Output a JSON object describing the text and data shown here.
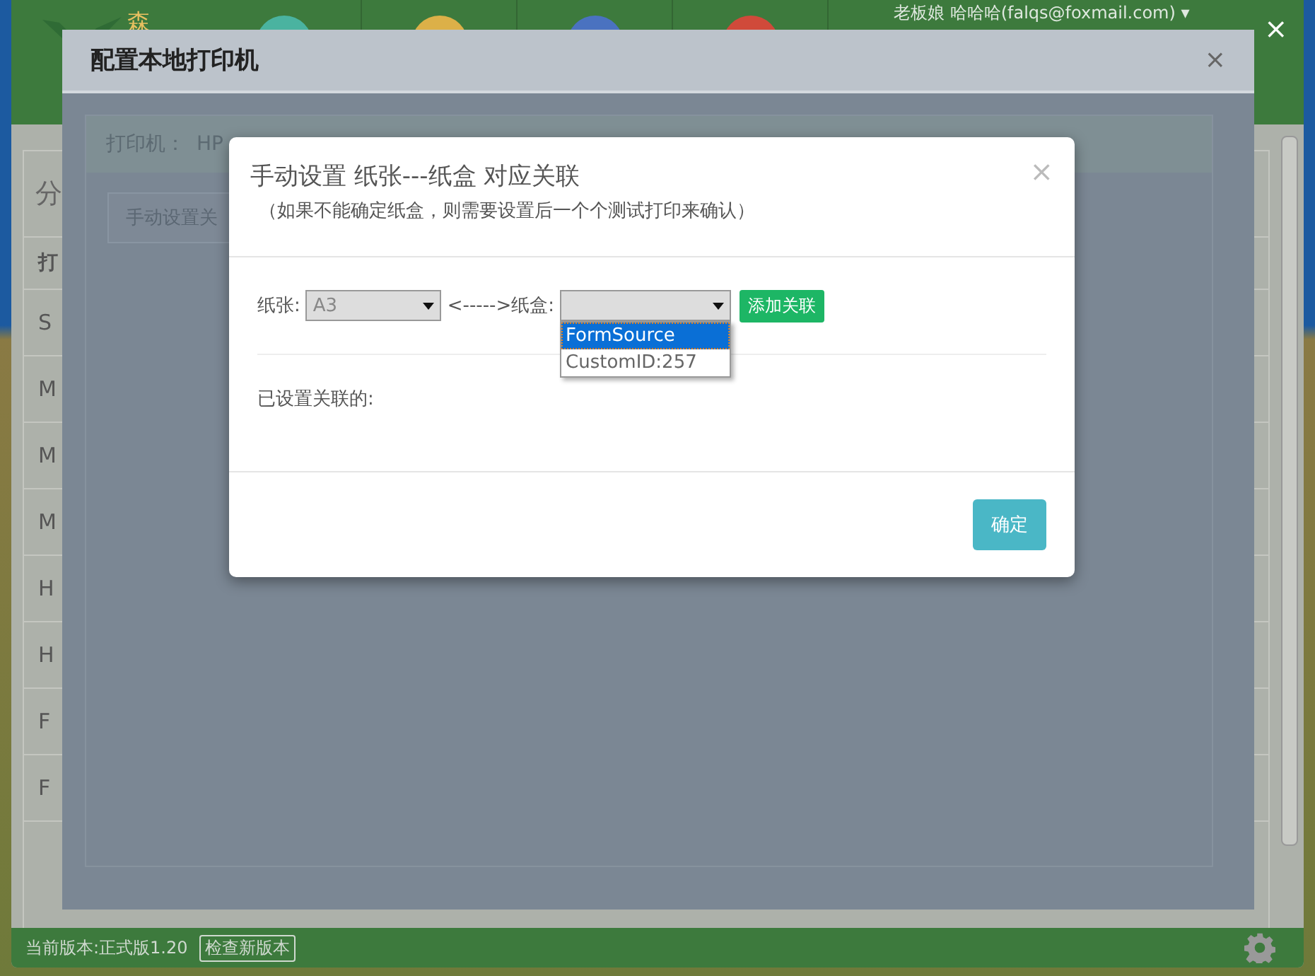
{
  "app": {
    "logo_text": "森",
    "nav_icons": [
      {
        "color": "#4ab3a0"
      },
      {
        "color": "#dcb048"
      },
      {
        "color": "#4a72c0"
      },
      {
        "color": "#d04a3a"
      }
    ],
    "user": "老板娘 哈哈哈(falqs@foxmail.com) ▾",
    "close": "×"
  },
  "side_panel": {
    "title": "分",
    "header": "打",
    "rows": [
      "S",
      "M",
      "M",
      "M",
      "H",
      "H",
      "F",
      "F"
    ]
  },
  "footer": {
    "version": "当前版本:正式版1.20",
    "check_button": "检查新版本"
  },
  "printer_dialog": {
    "title": "配置本地打印机",
    "close": "×",
    "printer_label": "打印机：",
    "printer_name": "HP",
    "manual_button": "手动设置关"
  },
  "mapping_dialog": {
    "title": "手动设置 纸张---纸盒 对应关联",
    "subtitle": "（如果不能确定纸盒，则需要设置后一个个测试打印来确认）",
    "close": "×",
    "paper_label": "纸张:",
    "paper_value": "A3",
    "arrow_label": "<----->纸盒:",
    "tray_open": true,
    "tray_options": [
      {
        "label": "FormSource",
        "selected": true
      },
      {
        "label": "CustomID:257",
        "selected": false
      }
    ],
    "add_button": "添加关联",
    "linked_label": "已设置关联的:",
    "ok_button": "确定"
  }
}
